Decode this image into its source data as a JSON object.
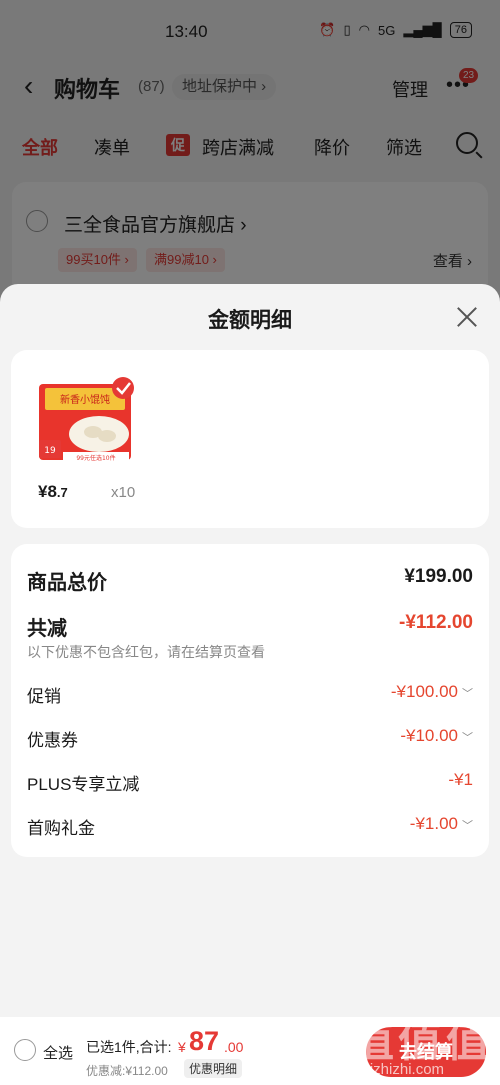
{
  "status_bar": {
    "time": "13:40",
    "network": "5G",
    "battery": "76"
  },
  "nav": {
    "back_icon": "chevron-left-icon",
    "title": "购物车",
    "count": "(87)",
    "address_protection": "地址保护中 ›",
    "manage": "管理",
    "more_icon": "more-dots-icon",
    "badge": "23"
  },
  "tabs": {
    "items": [
      "全部",
      "凑单",
      "跨店满减",
      "降价",
      "筛选"
    ],
    "promo_mark": "促",
    "search_icon": "search-icon"
  },
  "shop": {
    "name": "三全食品官方旗舰店 ›",
    "tags": [
      "99买10件 ›",
      "满99减10 ›"
    ],
    "view": "查看 ›"
  },
  "sheet": {
    "title": "金额明细",
    "close_icon": "close-icon",
    "goods": {
      "price_main": "¥8",
      "price_decimal": ".7",
      "quantity": "x10"
    },
    "product_image": {
      "brand_text": "新香小馄饨",
      "badge_text": "19",
      "promo_text": "99元任选10件"
    },
    "details": {
      "total_label": "商品总价",
      "total_value": "¥199.00",
      "reduce_label": "共减",
      "reduce_value": "-¥112.00",
      "note": "以下优惠不包含红包，请在结算页查看",
      "items": [
        {
          "label": "促销",
          "value": "-¥100.00",
          "expandable": true
        },
        {
          "label": "优惠券",
          "value": "-¥10.00",
          "expandable": true
        },
        {
          "label": "PLUS专享立减",
          "value": "-¥1",
          "expandable": false
        },
        {
          "label": "首购礼金",
          "value": "-¥1.00",
          "expandable": true
        }
      ]
    }
  },
  "bottom_bar": {
    "select_all": "全选",
    "selected_text": "已选1件,合计:",
    "yen": "¥",
    "amount": "87",
    "cents": ".00",
    "discount_text": "优惠减:¥112.00",
    "detail_button": "优惠明细",
    "checkout": "去结算"
  },
  "watermark": {
    "big": "值值值",
    "small": "zhizhizhi.com"
  },
  "colors": {
    "accent": "#e53935",
    "discount": "#e5462f"
  }
}
